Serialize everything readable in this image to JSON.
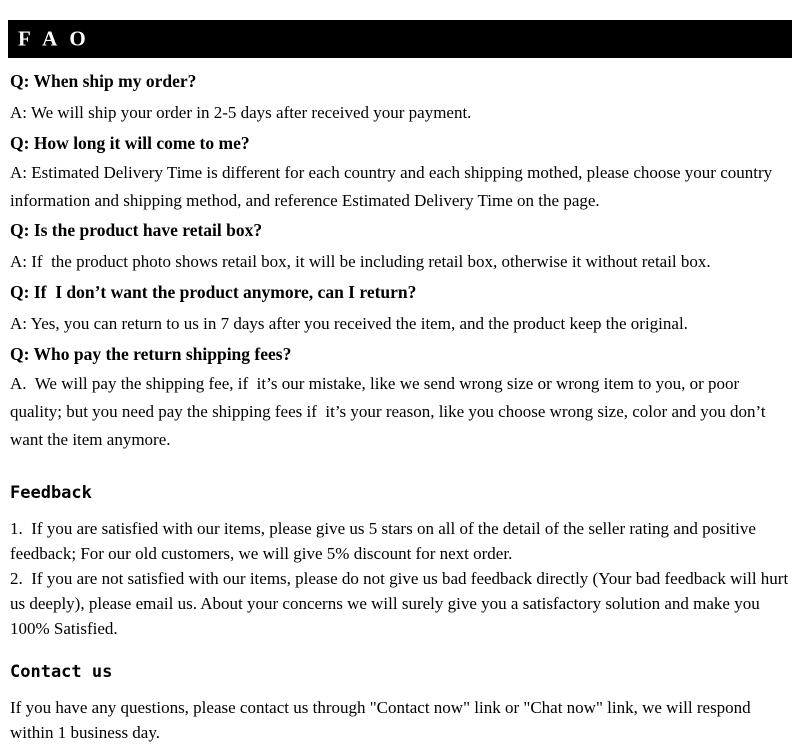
{
  "banner": {
    "title": "F A O",
    "background_color": "#000000",
    "text_color": "#ffffff"
  },
  "faq": [
    {
      "question": "Q: When ship my order?",
      "answer": "A: We will ship your order in 2-5 days after received your payment."
    },
    {
      "question": "Q: How long it will come to me?",
      "answer": "A: Estimated Delivery Time is different for each country and each shipping mothed, please choose your country information and shipping method, and reference Estimated Delivery Time on the page."
    },
    {
      "question": "Q: Is the product have retail box?",
      "answer": "A: If  the product photo shows retail box, it will be including retail box, otherwise it without retail box."
    },
    {
      "question": "Q: If  I don’t want the product anymore, can I return?",
      "answer": "A: Yes, you can return to us in 7 days after you received the item, and the product keep the original."
    },
    {
      "question": "Q: Who pay the return shipping fees?",
      "answer": "A.  We will pay the shipping fee, if  it’s our mistake, like we send wrong size or wrong item to you, or poor quality; but you need pay the shipping fees if  it’s your reason, like you choose wrong size, color and you don’t want the item anymore."
    }
  ],
  "feedback": {
    "heading": "Feedback",
    "item_1": "1.  If you are satisfied with our items, please give us 5 stars on all of the detail of the seller rating and positive feedback; For our old customers, we will give 5% discount for next order.",
    "item_2": "2.  If you are not satisfied with our items, please do not give us bad feedback directly (Your bad feedback will hurt us deeply), please email us. About your concerns we will surely give you a satisfactory solution and make you 100% Satisfied."
  },
  "contact": {
    "heading": "Contact us",
    "paragraph": "If you have any questions, please contact us through \"Contact now\" link or \"Chat now\" link, we will respond within 1 business day."
  }
}
